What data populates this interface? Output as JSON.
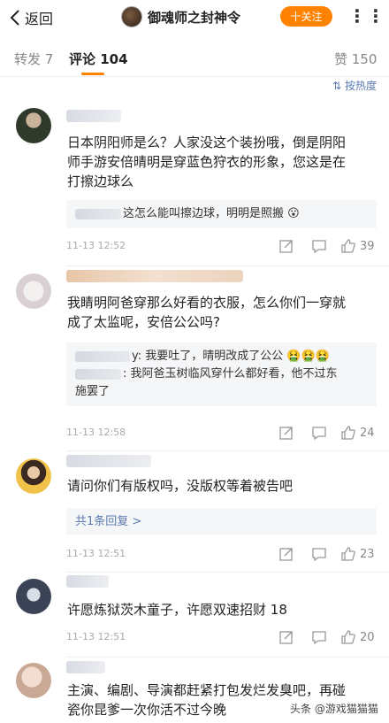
{
  "header": {
    "back_label": "返回",
    "title": "御魂师之封神令",
    "follow_label": "十关注",
    "more_label": "⋮⋮"
  },
  "tabs": {
    "repost": "转发 7",
    "comments": "评论 104",
    "likes": "赞 150"
  },
  "sort_label": "⇅ 按热度",
  "colors": {
    "accent": "#ff8200",
    "link": "#5b7ab0"
  },
  "comments": [
    {
      "text_lines": [
        "日本阴阳师是么？人家没这个装扮哦，倒是阴阳",
        "师手游安倍晴明是穿蓝色狩衣的形象，您这是在",
        "打擦边球么"
      ],
      "replies": [
        {
          "text": "这怎么能叫擦边球，明明是照搬 😮"
        }
      ],
      "time": "11-13 12:52",
      "likes": "39"
    },
    {
      "text_lines": [
        "我睛明阿爸穿那么好看的衣服，怎么你们一穿就",
        "成了太监呢，安倍公公吗?"
      ],
      "replies": [
        {
          "text": "y: 我要吐了，晴明改成了公公 🤮🤮🤮"
        },
        {
          "text": ": 我阿爸玉树临风穿什么都好看，他不过东"
        },
        {
          "text": "施罢了"
        }
      ],
      "time": "11-13 12:58",
      "likes": "24"
    },
    {
      "text_lines": [
        "请问你们有版权吗，没版权等着被告吧"
      ],
      "replies": [
        {
          "text": "共1条回复 >"
        }
      ],
      "time": "11-13 12:51",
      "likes": "23"
    },
    {
      "text_lines": [
        "许愿炼狱茨木童子，许愿双速招财 18"
      ],
      "replies": [],
      "time": "11-13 12:51",
      "likes": "20"
    },
    {
      "text_lines": [
        "主演、编剧、导演都赶紧打包发烂发臭吧，再碰",
        "瓷你昆爹一次你活不过今晚"
      ],
      "replies": [],
      "time": "",
      "likes": ""
    }
  ],
  "icons": [
    "back-chevron-icon",
    "share-icon",
    "comment-icon",
    "like-icon"
  ],
  "watermark": "头条 @游戏猫猫猫"
}
